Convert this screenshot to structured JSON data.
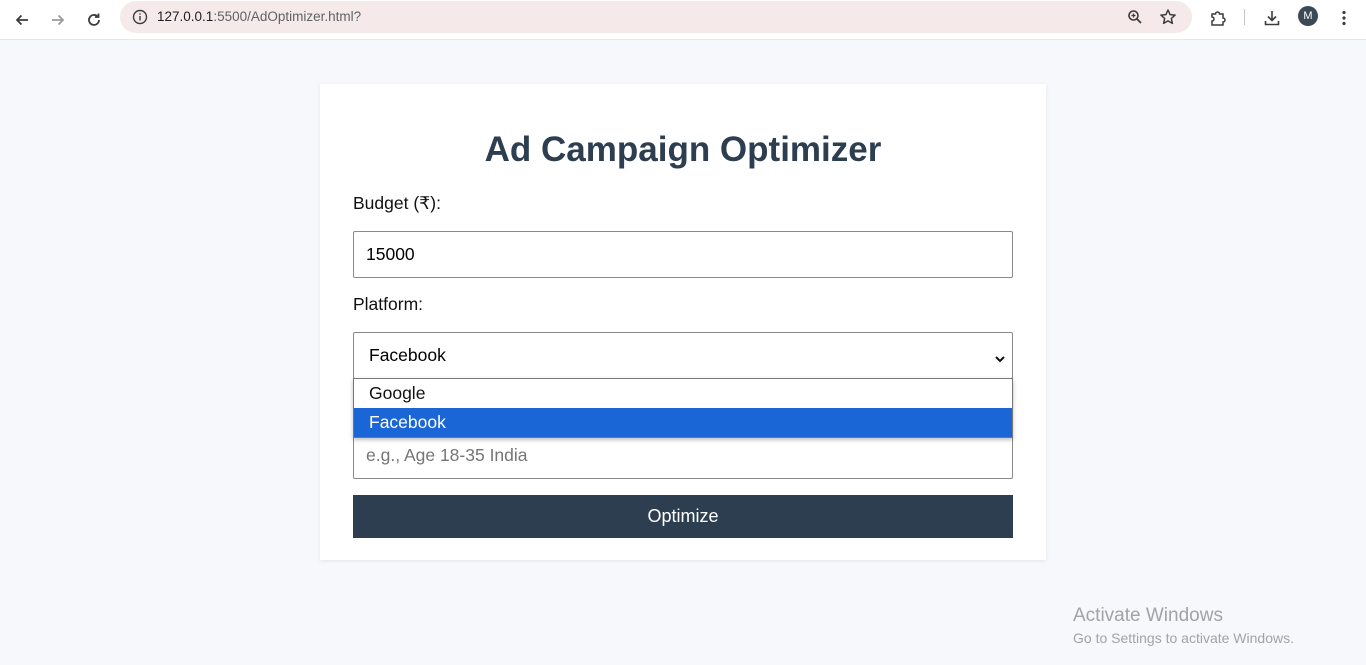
{
  "browser": {
    "url_host": "127.0.0.1",
    "url_path": ":5500/AdOptimizer.html?",
    "avatar_letter": "M"
  },
  "page": {
    "title": "Ad Campaign Optimizer",
    "budget_label": "Budget (₹):",
    "budget_value": "15000",
    "platform_label": "Platform:",
    "platform_selected": "Facebook",
    "platform_options": [
      "Google",
      "Facebook"
    ],
    "audience_placeholder": "e.g., Age 18-35 India",
    "optimize_label": "Optimize"
  },
  "watermark": {
    "title": "Activate Windows",
    "subtitle": "Go to Settings to activate Windows."
  },
  "colors": {
    "accent": "#2c3e50",
    "selected_option": "#1a66d6"
  }
}
